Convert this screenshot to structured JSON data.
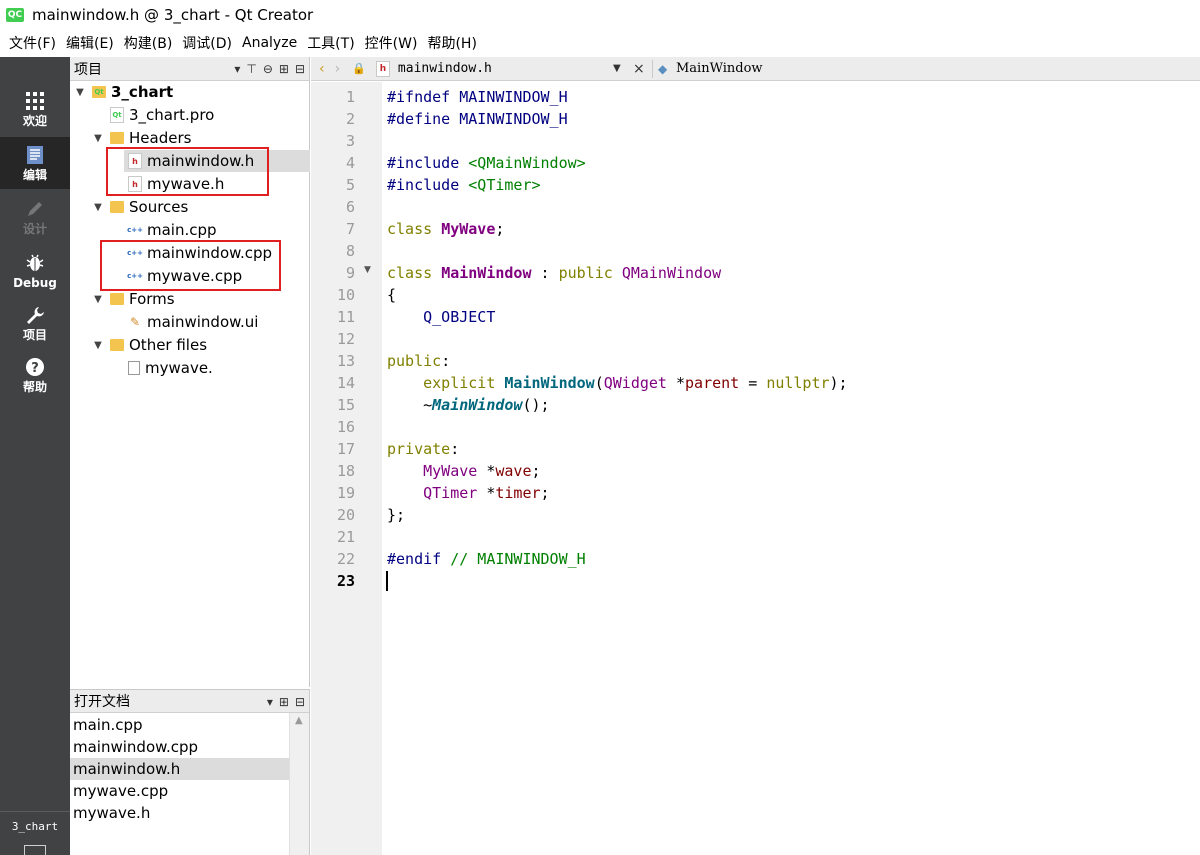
{
  "window": {
    "app_icon": "QC",
    "title": "mainwindow.h @ 3_chart - Qt Creator"
  },
  "menubar": {
    "items": [
      "文件(F)",
      "编辑(E)",
      "构建(B)",
      "调试(D)",
      "Analyze",
      "工具(T)",
      "控件(W)",
      "帮助(H)"
    ]
  },
  "modes": [
    {
      "label": "欢迎",
      "icon": "grid-icon"
    },
    {
      "label": "编辑",
      "icon": "document-edit-icon"
    },
    {
      "label": "设计",
      "icon": "pencil-icon"
    },
    {
      "label": "Debug",
      "icon": "bug-icon"
    },
    {
      "label": "项目",
      "icon": "wrench-icon"
    },
    {
      "label": "帮助",
      "icon": "help-icon"
    }
  ],
  "kit_label": "3_chart",
  "project_pane": {
    "title": "项目",
    "tree": [
      {
        "label": "3_chart"
      },
      {
        "label": "3_chart.pro"
      },
      {
        "label": "Headers"
      },
      {
        "label": "mainwindow.h"
      },
      {
        "label": "mywave.h"
      },
      {
        "label": "Sources"
      },
      {
        "label": "main.cpp"
      },
      {
        "label": "mainwindow.cpp"
      },
      {
        "label": "mywave.cpp"
      },
      {
        "label": "Forms"
      },
      {
        "label": "mainwindow.ui"
      },
      {
        "label": "Other files"
      },
      {
        "label": "mywave."
      }
    ]
  },
  "open_documents": {
    "title": "打开文档",
    "items": [
      "main.cpp",
      "mainwindow.cpp",
      "mainwindow.h",
      "mywave.cpp",
      "mywave.h"
    ],
    "selected": "mainwindow.h"
  },
  "editor": {
    "file_name": "mainwindow.h",
    "symbol": "MainWindow",
    "current_line": "23",
    "line_numbers": [
      "1",
      "2",
      "3",
      "4",
      "5",
      "6",
      "7",
      "8",
      "9",
      "10",
      "11",
      "12",
      "13",
      "14",
      "15",
      "16",
      "17",
      "18",
      "19",
      "20",
      "21",
      "22",
      "23"
    ],
    "code": {
      "l1_pp": "#ifndef",
      "l1_mac": "MAINWINDOW_H",
      "l2_pp": "#define",
      "l2_mac": "MAINWINDOW_H",
      "l4_pp": "#include",
      "l4_inc": "<QMainWindow>",
      "l5_pp": "#include",
      "l5_inc": "<QTimer>",
      "l7_kw": "class",
      "l7_cls": "MyWave",
      "l7_end": ";",
      "l9_kw": "class",
      "l9_cls": "MainWindow",
      "l9_colon": " : ",
      "l9_kw2": "public",
      "l9_base": "QMainWindow",
      "l10": "{",
      "l11": "Q_OBJECT",
      "l13_kw": "public",
      "l13_colon": ":",
      "l14_kw": "explicit",
      "l14_fn": "MainWindow",
      "l14_p1": "(",
      "l14_ty": "QWidget",
      "l14_p2": " *",
      "l14_var": "parent",
      "l14_p3": " = ",
      "l14_kw2": "nullptr",
      "l14_p4": ");",
      "l15_tilde": "~",
      "l15_fn": "MainWindow",
      "l15_end": "();",
      "l17_kw": "private",
      "l17_colon": ":",
      "l18_ty": "MyWave",
      "l18_p": " *",
      "l18_var": "wave",
      "l18_end": ";",
      "l19_ty": "QTimer",
      "l19_p": " *",
      "l19_var": "timer",
      "l19_end": ";",
      "l20": "};",
      "l22_pp": "#endif",
      "l22_cm": "// MAINWINDOW_H"
    }
  }
}
